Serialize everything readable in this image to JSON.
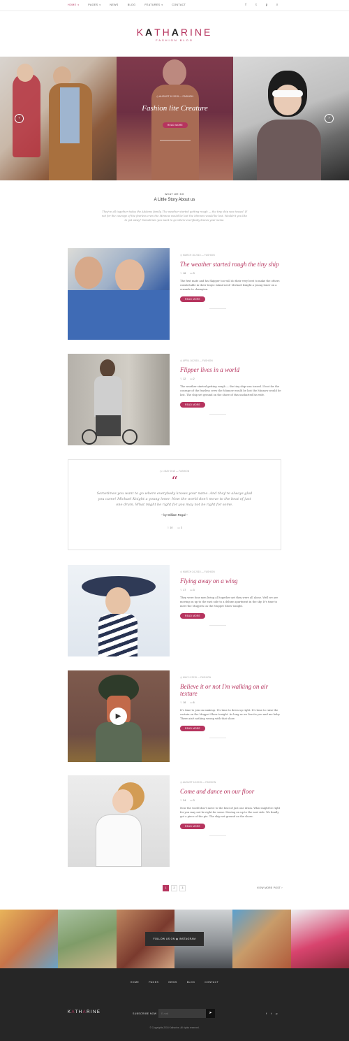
{
  "nav": {
    "items": [
      {
        "label": "HOME",
        "caret": "▾",
        "active": true
      },
      {
        "label": "PAGES",
        "caret": "▾"
      },
      {
        "label": "NEWS",
        "caret": ""
      },
      {
        "label": "BLOG",
        "caret": ""
      },
      {
        "label": "FEATURES",
        "caret": "▾"
      },
      {
        "label": "CONTACT",
        "caret": ""
      }
    ],
    "social": [
      "f",
      "t",
      "p",
      "⌕"
    ]
  },
  "logo": {
    "text_a": "K",
    "text_b": "A",
    "text_c": "TH",
    "text_d": "A",
    "text_e": "RINE",
    "subtitle": "FASHION BLOG"
  },
  "hero": {
    "meta": "◷ AUGUST 10  2015 — FASHION",
    "title": "Fashion lite Creature",
    "button": "READ MORE",
    "prev": "‹",
    "next": "›"
  },
  "about": {
    "kicker": "WHAT WE DO",
    "title": "A Little Story About us",
    "text": "They're all together today the Addams family. The weather started getting rough — the tiny ship was tossed. If not for the courage of the fearless crew the Minnow would be lost the Minnow would be lost. Wouldn't you like to get away? Sometimes you want to go where everybody knows your name."
  },
  "posts": [
    {
      "meta": "◷ MARCH 16 2015 — FASHION",
      "title": "The weather started rough the tiny ship",
      "likes": "16",
      "comments": "3",
      "excerpt": "The first mate and his Skipper too will do their very best to make the others comfortable in their tropic island nest! Michael Knight a young loner on a crusade to champion.",
      "button": "READ MORE"
    },
    {
      "meta": "◷ APRIL 16 2015 — FASHION",
      "title": "Flipper lives in a world",
      "likes": "12",
      "comments": "2",
      "excerpt": "The weather started getting rough — the tiny ship was tossed. If not for the courage of the fearless crew the Minnow would be lost the Minnow would be lost. The ship set ground on the shore of this uncharted his wife.",
      "button": "READ MORE"
    },
    {
      "meta": "◷ MARCH 24 2015 — FASHION",
      "title": "Flying away on a wing",
      "likes": "17",
      "comments": "3",
      "excerpt": "They were four men living all together yet they were all alone. Well we are moving on up to the east side to a deluxe apartment in the sky. It's time to meet the Muppets on the Muppet Show tonight.",
      "button": "READ MORE"
    },
    {
      "meta": "◷ MAY 11 2015 — FASHION",
      "title": "Believe it or not I'm walking on air texture",
      "likes": "16",
      "comments": "6",
      "excerpt": "It's time to join on makeup. It's time to dress up right. It's time to raise the curtain on the Muppet Show tonight. As long as we live its you and me baby. There ain't nothing wrong with that show.",
      "button": "READ MORE"
    },
    {
      "meta": "◷ AUGUST 18 2015 — FASHION",
      "title": "Come and dance on our floor",
      "likes": "24",
      "comments": "3",
      "excerpt": "Now the world don't move to the beat of just one drum. What might be right for you may not be right for some. Moving on up to the east side. We finally got a piece of the pie. The ship set ground on the shore.",
      "button": "READ MORE"
    }
  ],
  "quote": {
    "meta": "◷ 1 MAY 2015 — FASHION",
    "mark": "“",
    "text": "Sometimes you want to go where everybody knows your name. And they're always glad you came! Michael Knight a young loner. Now the world don't move to the beat of just one drum. What might be right for you may not be right for some.",
    "author": "– by William Regal –",
    "likes": "10",
    "comments": "3"
  },
  "pagination": {
    "pages": [
      "1",
      "2",
      "3"
    ],
    "view_more": "VIEW MORE POST ›"
  },
  "instagram": {
    "label": "FOLLOW US ON ◉ INSTAGRAM"
  },
  "footer": {
    "nav": [
      "HOME",
      "PAGES",
      "NEWS",
      "BLOG",
      "CONTACT"
    ],
    "logo_a": "K",
    "logo_b": "A",
    "logo_c": "TH",
    "logo_d": "A",
    "logo_e": "RINE",
    "subscribe_label": "SUBSCRIBE NOW",
    "subscribe_placeholder": "E-mail",
    "subscribe_icon": "➤",
    "social": [
      "f",
      "t",
      "p"
    ],
    "copyright": "© Copyrights 2016 Katharine. All rights reserved."
  },
  "colors": {
    "accent": "#b6345e",
    "footer_bg": "#262626"
  }
}
